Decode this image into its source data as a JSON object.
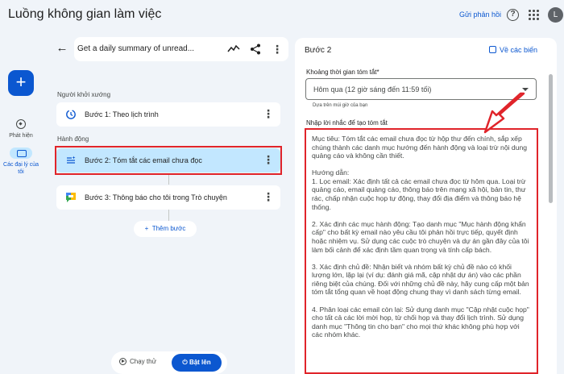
{
  "app": {
    "title": "Luồng không gian làm việc",
    "feedback": "Gửi phản hồi",
    "avatar_letter": "L",
    "help_glyph": "?"
  },
  "rail": {
    "new_glyph": "+",
    "discover": "Phát hiện",
    "agents": "Các đại lý của tôi"
  },
  "flow": {
    "name": "Get a daily summary of unread...",
    "starter_label": "Người khởi xướng",
    "actions_label": "Hành động",
    "steps": [
      {
        "label": "Bước 1: Theo lịch trình",
        "icon": "schedule-icon"
      },
      {
        "label": "Bước 2: Tóm tắt các email chưa đọc",
        "icon": "summarize-icon"
      },
      {
        "label": "Bước 3: Thông báo cho tôi trong Trò chuyện",
        "icon": "chat-icon"
      }
    ],
    "add_step": "Thêm bước",
    "run": "Chạy thử",
    "turn_on": "Bật lên"
  },
  "detail": {
    "title": "Bước 2",
    "variables_link": "Về các biến",
    "period_label": "Khoảng thời gian tóm tắt*",
    "period_value": "Hôm qua (12 giờ sáng đến 11:59 tối)",
    "timezone_hint": "Dựa trên múi giờ của bạn",
    "prompt_label": "Nhập lời nhắc để tạo tóm tắt",
    "prompt_paragraphs": [
      "Mục tiêu: Tóm tắt các email chưa đọc từ hộp thư đến chính, sắp xếp chúng thành các danh mục hướng đến hành động và loại trừ nội dung quảng cáo và không cần thiết.",
      "Hướng dẫn:",
      "1. Lọc email: Xác định tất cả các email chưa đọc từ hôm qua. Loại trừ quảng cáo, email quảng cáo, thông báo trên mạng xã hội, bản tin, thư rác, chấp nhận cuộc họp tự động, thay đổi địa điểm và thông báo hệ thống.",
      "2. Xác định các mục hành động: Tạo danh mục \"Mục hành động khẩn cấp\" cho bất kỳ email nào yêu cầu tôi phản hồi trực tiếp, quyết định hoặc nhiệm vụ. Sử dụng các cuộc trò chuyện và dự án gần đây của tôi làm bối cảnh để xác định tầm quan trọng và tính cấp bách.",
      "3. Xác định chủ đề: Nhận biết và nhóm bất kỳ chủ đề nào có khối lượng lớn, lặp lại (ví dụ: đánh giá mã, cập nhật dự án) vào các phần riêng biệt của chúng. Đối với những chủ đề này, hãy cung cấp một bản tóm tắt tổng quan về hoạt động chung thay vì danh sách từng email.",
      "4. Phân loại các email còn lại: Sử dụng danh mục \"Cập nhật cuộc họp\" cho tất cả các lời mời họp, từ chối họp và thay đổi lịch trình. Sử dụng danh mục \"Thông tin cho bạn\" cho mọi thứ khác không phù hợp với các nhóm khác."
    ]
  },
  "colors": {
    "accent": "#0b57d0",
    "highlight": "#e0242a",
    "selected": "#c2e7ff",
    "background": "#f0f4f9"
  }
}
